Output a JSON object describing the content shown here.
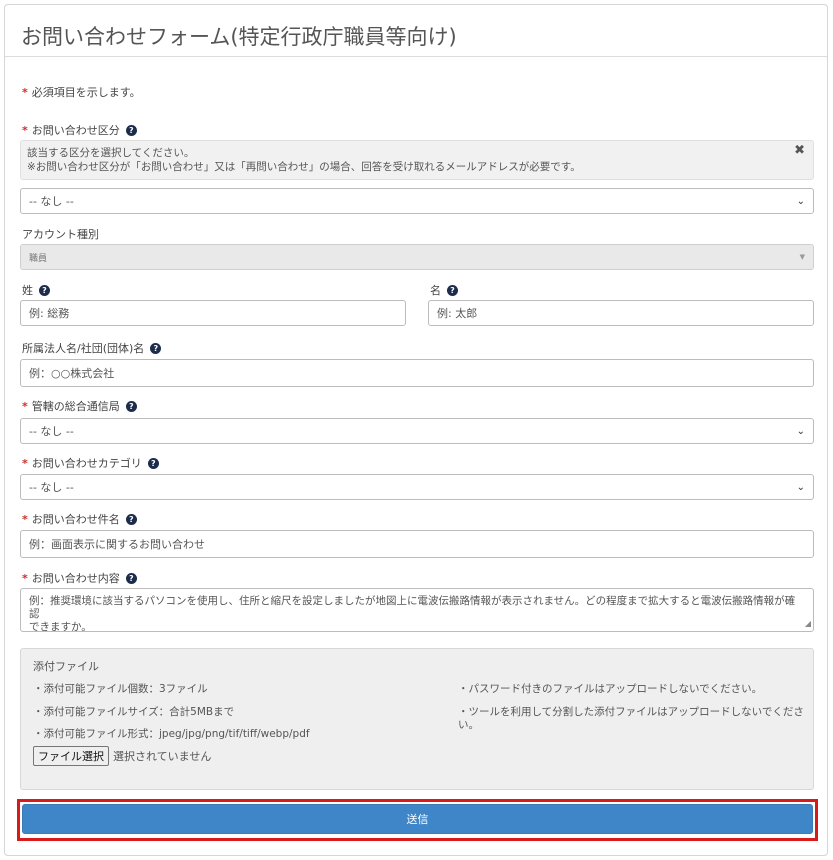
{
  "header": {
    "title": "お問い合わせフォーム(特定行政庁職員等向け)"
  },
  "required_note": "必須項目を示します。",
  "inquiry_type": {
    "label": "お問い合わせ区分",
    "notice_line1": "該当する区分を選択してください。",
    "notice_line2": "※お問い合わせ区分が「お問い合わせ」又は「再問い合わせ」の場合、回答を受け取れるメールアドレスが必要です。",
    "selected": "-- なし --"
  },
  "account_type": {
    "label": "アカウント種別",
    "selected": "職員"
  },
  "last_name": {
    "label": "姓",
    "placeholder": "例: 総務"
  },
  "first_name": {
    "label": "名",
    "placeholder": "例: 太郎"
  },
  "organization": {
    "label": "所属法人名/社団(団体)名",
    "placeholder": "例：○○株式会社"
  },
  "bureau": {
    "label": "管轄の総合通信局",
    "selected": "-- なし --"
  },
  "category": {
    "label": "お問い合わせカテゴリ",
    "selected": "-- なし --"
  },
  "subject": {
    "label": "お問い合わせ件名",
    "placeholder": "例：画面表示に関するお問い合わせ"
  },
  "content": {
    "label": "お問い合わせ内容",
    "placeholder_line1": "例：推奨環境に該当するパソコンを使用し、住所と縮尺を設定しましたが地図上に電波伝搬路情報が表示されません。どの程度まで拡大すると電波伝搬路情報が確認",
    "placeholder_line2": "できますか。"
  },
  "attachments": {
    "title": "添付ファイル",
    "left_items": [
      "・添付可能ファイル個数：3ファイル",
      "・添付可能ファイルサイズ：合計5MBまで",
      "・添付可能ファイル形式：jpeg/jpg/png/tif/tiff/webp/pdf"
    ],
    "right_items": [
      "・パスワード付きのファイルはアップロードしないでください。",
      "・ツールを利用して分割した添付ファイルはアップロードしないでくださ",
      "い。"
    ],
    "file_button": "ファイル選択",
    "file_status": "選択されていません"
  },
  "submit": {
    "label": "送信"
  },
  "colors": {
    "accent": "#3f86c8",
    "required": "#c9302c",
    "highlight": "#d91a1a"
  }
}
